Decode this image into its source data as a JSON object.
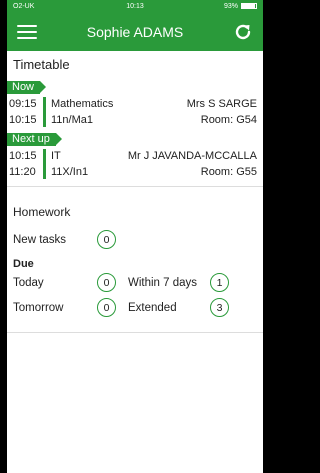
{
  "status": {
    "carrier": "O2-UK",
    "time": "10:13",
    "battery": "93%"
  },
  "header": {
    "title": "Sophie ADAMS"
  },
  "timetable": {
    "title": "Timetable",
    "now_label": "Now",
    "next_label": "Next up",
    "now": {
      "start": "09:15",
      "end": "10:15",
      "subject": "Mathematics",
      "teacher": "Mrs S SARGE",
      "group": "11n/Ma1",
      "room": "Room: G54"
    },
    "next": {
      "start": "10:15",
      "end": "11:20",
      "subject": "IT",
      "teacher": "Mr J JAVANDA-MCCALLA",
      "group": "11X/In1",
      "room": "Room: G55"
    }
  },
  "homework": {
    "title": "Homework",
    "new_tasks_label": "New tasks",
    "new_tasks_count": "0",
    "due_label": "Due",
    "today_label": "Today",
    "today_count": "0",
    "within7_label": "Within 7 days",
    "within7_count": "1",
    "tomorrow_label": "Tomorrow",
    "tomorrow_count": "0",
    "extended_label": "Extended",
    "extended_count": "3"
  },
  "colors": {
    "brand": "#2a9a3a"
  },
  "icons": {
    "menu": "menu-icon",
    "refresh": "refresh-icon"
  }
}
